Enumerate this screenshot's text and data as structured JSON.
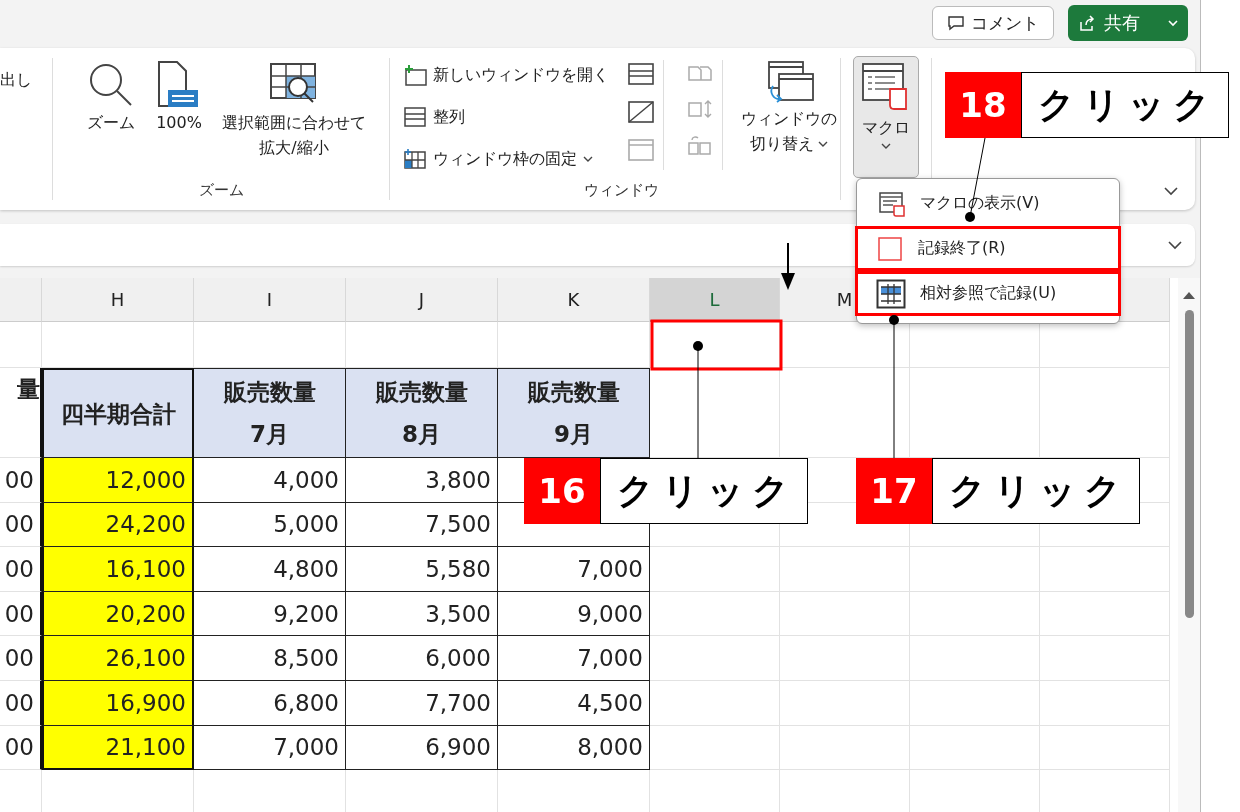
{
  "top_bar": {
    "comment_button": "コメント",
    "share_button": "共有"
  },
  "ribbon": {
    "clipped_label": "出し",
    "zoom_group": {
      "label": "ズーム",
      "buttons": [
        {
          "kind": "zoom",
          "lines": [
            "ズーム"
          ]
        },
        {
          "kind": "hundred",
          "lines": [
            "100%"
          ]
        },
        {
          "kind": "fit",
          "lines": [
            "選択範囲に合わせて",
            "拡大/縮小"
          ]
        }
      ]
    },
    "window_group": {
      "label": "ウィンドウ",
      "small_buttons": [
        {
          "kind": "new",
          "label": "新しいウィンドウを開く",
          "dropdown": false
        },
        {
          "kind": "arrange",
          "label": "整列",
          "dropdown": false
        },
        {
          "kind": "freeze",
          "label": "ウィンドウ枠の固定",
          "dropdown": true
        }
      ],
      "switch_button": {
        "lines": [
          "ウィンドウの",
          "切り替え"
        ],
        "dropdown": true
      }
    },
    "macro_button": {
      "label": "マクロ",
      "pressed": true
    }
  },
  "macro_menu": {
    "items": [
      {
        "kind": "view",
        "label": "マクロの表示(V)",
        "outlined": false
      },
      {
        "kind": "stop",
        "label": "記録終了(R)",
        "outlined": true
      },
      {
        "kind": "relative",
        "label": "相対参照で記録(U)",
        "outlined": true
      }
    ]
  },
  "sheet": {
    "columns": [
      {
        "selected": false
      },
      {
        "label": "H",
        "selected": false
      },
      {
        "label": "I",
        "selected": false
      },
      {
        "label": "J",
        "selected": false
      },
      {
        "label": "K",
        "selected": false
      },
      {
        "label": "L",
        "selected": true
      },
      {
        "label": "M",
        "selected": false
      },
      {},
      {
        "selected": false
      }
    ],
    "header_row": [
      {
        "lines": [
          "量"
        ]
      },
      {
        "lines": [
          "四半期合計"
        ]
      },
      {
        "lines": [
          "販売数量",
          "7月"
        ]
      },
      {
        "lines": [
          "販売数量",
          "8月"
        ]
      },
      {
        "lines": [
          "販売数量",
          "9月"
        ]
      }
    ],
    "rows": [
      [
        "00",
        "12,000",
        "4,000",
        "3,800",
        null
      ],
      [
        "00",
        "24,200",
        "5,000",
        "7,500",
        null
      ],
      [
        "00",
        "16,100",
        "4,800",
        "5,580",
        "7,000"
      ],
      [
        "00",
        "20,200",
        "9,200",
        "3,500",
        "9,000"
      ],
      [
        "00",
        "26,100",
        "8,500",
        "6,000",
        "7,000"
      ],
      [
        "00",
        "16,900",
        "6,800",
        "7,700",
        "4,500"
      ],
      [
        "00",
        "21,100",
        "7,000",
        "6,900",
        "8,000"
      ]
    ]
  },
  "callouts": [
    {
      "number": "16",
      "text": "クリック"
    },
    {
      "number": "17",
      "text": "クリック"
    },
    {
      "number": "18",
      "text": "クリック"
    }
  ]
}
